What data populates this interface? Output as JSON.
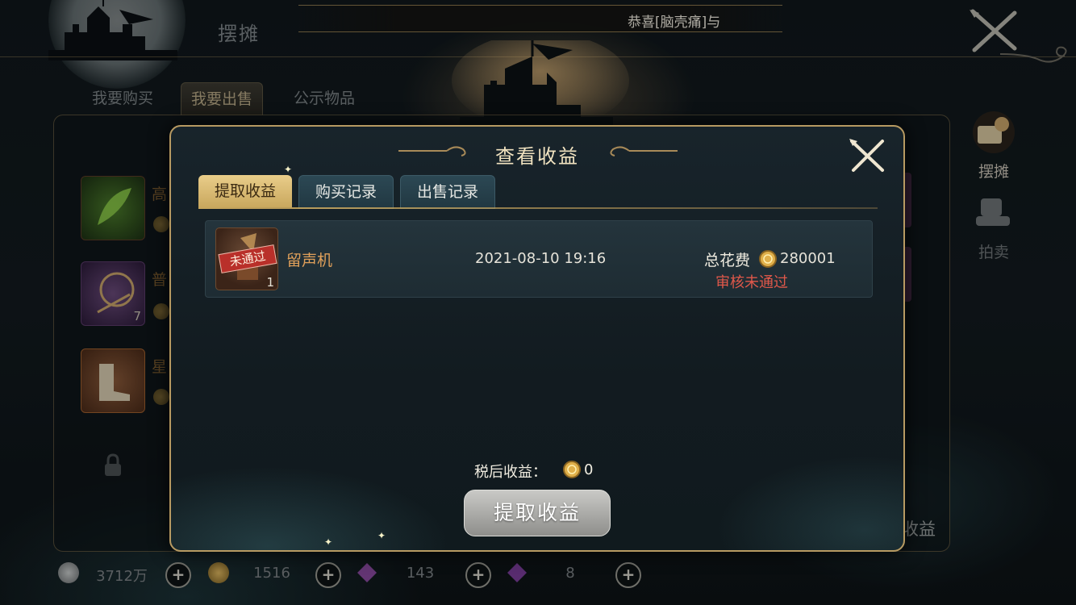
{
  "header": {
    "page_title": "摆摊",
    "notice": "恭喜[脑壳痛]与"
  },
  "main_tabs": [
    {
      "label": "我要购买"
    },
    {
      "label": "我要出售",
      "active": true
    },
    {
      "label": "公示物品"
    }
  ],
  "slots": [
    {
      "label": "高",
      "count": ""
    },
    {
      "label": "普",
      "count": "7"
    },
    {
      "label": "星",
      "count": ""
    }
  ],
  "right_menu": [
    {
      "label": "摆摊",
      "icon": "stall-icon"
    },
    {
      "label": "拍卖",
      "icon": "auction-icon"
    }
  ],
  "bottom_partial_label": "收益",
  "resources": [
    {
      "icon": "silver-coin-icon",
      "value": "3712万",
      "color": "#9ea3a4"
    },
    {
      "icon": "gold-coin-icon",
      "value": "1516",
      "color": "#c9a24a"
    },
    {
      "icon": "purple-crystal-icon",
      "value": "143",
      "color": "#8a4aa0"
    },
    {
      "icon": "violet-gem-icon",
      "value": "8",
      "color": "#7a3e9a"
    }
  ],
  "dialog": {
    "title": "查看收益",
    "tabs": [
      {
        "label": "提取收益",
        "active": true
      },
      {
        "label": "购买记录"
      },
      {
        "label": "出售记录"
      }
    ],
    "records": [
      {
        "stamp": "未通过",
        "quantity": "1",
        "name": "留声机",
        "time": "2021-08-10  19:16",
        "cost_label": "总花费",
        "cost": "280001",
        "status": "审核未通过"
      }
    ],
    "after_tax_label": "税后收益：",
    "after_tax_value": "0",
    "withdraw_label": "提取收益"
  },
  "colors": {
    "gold_border": "#b79a62",
    "active_tab": "#e9cd8a",
    "status_red": "#e0584a",
    "item_name": "#e0a05a"
  }
}
